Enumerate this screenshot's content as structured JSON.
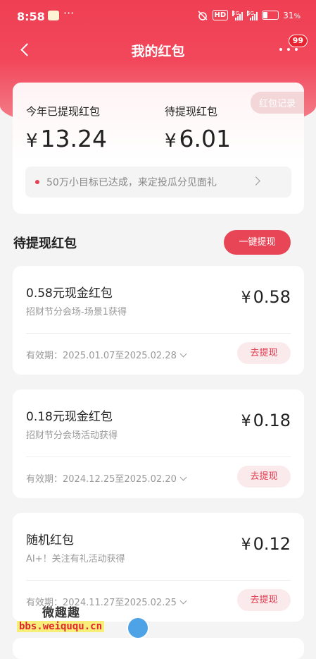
{
  "status_bar": {
    "time": "8:58",
    "dots": "···",
    "hd": "HD",
    "net1": "5G",
    "net2": "5G",
    "battery": "31",
    "battery_unit": "%"
  },
  "nav": {
    "title": "我的红包",
    "badge_count": "99"
  },
  "summary": {
    "withdrawn_label": "今年已提现红包",
    "withdrawn_amount": "13.24",
    "pending_label": "待提现红包",
    "pending_amount": "6.01",
    "currency": "¥",
    "record_button": "红包记录",
    "goal_text": "50万小目标已达成，来定投瓜分见面礼"
  },
  "section": {
    "title": "待提现红包",
    "withdraw_all_button": "一键提现"
  },
  "packets": [
    {
      "name": "0.58元现金红包",
      "source": "招财节分会场-场景1获得",
      "amount": "0.58",
      "validity": "有效期：2025.01.07至2025.02.28",
      "button": "去提现"
    },
    {
      "name": "0.18元现金红包",
      "source": "招财节分会场活动获得",
      "amount": "0.18",
      "validity": "有效期：2024.12.25至2025.02.20",
      "button": "去提现"
    },
    {
      "name": "随机红包",
      "source": "AI+！关注有礼活动获得",
      "amount": "0.12",
      "validity": "有效期：2024.11.27至2025.02.25",
      "button": "去提现"
    }
  ],
  "watermark": {
    "line1": "微趣趣",
    "line2": "bbs.weiququ.cn"
  },
  "colors": {
    "brand_red": "#ef3f53",
    "button_red": "#e84657",
    "soft_pink": "#fbeaec"
  }
}
